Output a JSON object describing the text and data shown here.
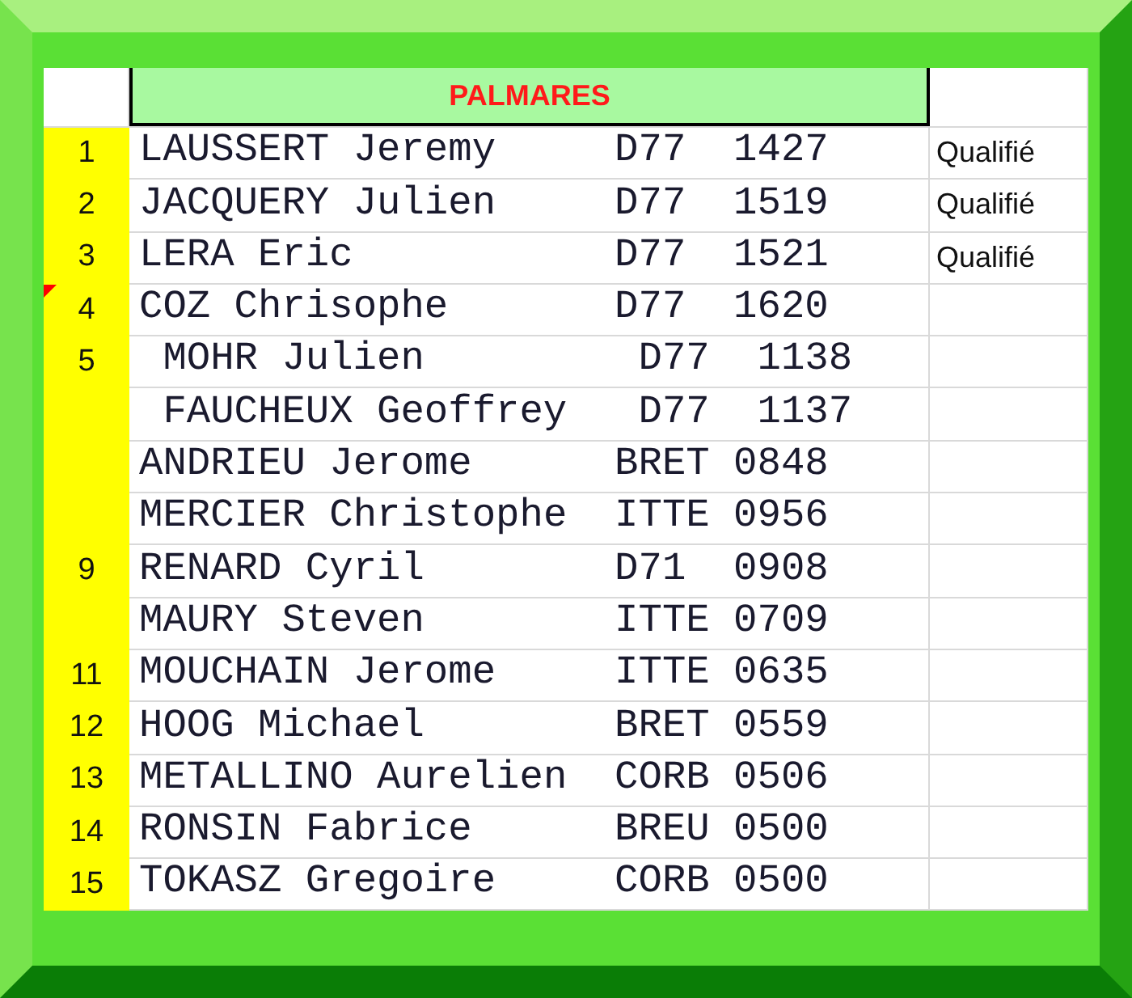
{
  "header": {
    "title": "PALMARES"
  },
  "rows": [
    {
      "rank": "1",
      "name": "LAUSSERT Jeremy",
      "club": "D77",
      "points": "1427",
      "status": "Qualifié",
      "indent": false,
      "comment": false
    },
    {
      "rank": "2",
      "name": "JACQUERY Julien",
      "club": "D77",
      "points": "1519",
      "status": "Qualifié",
      "indent": false,
      "comment": false
    },
    {
      "rank": "3",
      "name": "LERA Eric",
      "club": "D77",
      "points": "1521",
      "status": "Qualifié",
      "indent": false,
      "comment": false
    },
    {
      "rank": "4",
      "name": "COZ Chrisophe",
      "club": "D77",
      "points": "1620",
      "indent": false,
      "comment": true
    },
    {
      "rank": "5",
      "name": "MOHR Julien",
      "club": "D77",
      "points": "1138",
      "indent": true,
      "comment": false
    },
    {
      "name": "FAUCHEUX Geoffrey",
      "club": "D77",
      "points": "1137",
      "indent": true,
      "comment": false
    },
    {
      "name": "ANDRIEU Jerome",
      "club": "BRET",
      "points": "0848",
      "indent": false,
      "comment": false
    },
    {
      "name": "MERCIER Christophe",
      "club": "ITTE",
      "points": "0956",
      "indent": false,
      "comment": false
    },
    {
      "rank": "9",
      "name": "RENARD Cyril",
      "club": "D71",
      "points": "0908",
      "indent": false,
      "comment": false
    },
    {
      "name": "MAURY Steven",
      "club": "ITTE",
      "points": "0709",
      "indent": false,
      "comment": false
    },
    {
      "rank": "11",
      "name": "MOUCHAIN Jerome",
      "club": "ITTE",
      "points": "0635",
      "indent": false,
      "comment": false
    },
    {
      "rank": "12",
      "name": "HOOG Michael",
      "club": "BRET",
      "points": "0559",
      "indent": false,
      "comment": false
    },
    {
      "rank": "13",
      "name": "METALLINO Aurelien",
      "club": "CORB",
      "points": "0506",
      "indent": false,
      "comment": false
    },
    {
      "rank": "14",
      "name": "RONSIN Fabrice",
      "club": "BREU",
      "points": "0500",
      "indent": false,
      "comment": false
    },
    {
      "rank": "15",
      "name": "TOKASZ Gregoire",
      "club": "CORB",
      "points": "0500",
      "indent": false,
      "comment": false
    }
  ]
}
